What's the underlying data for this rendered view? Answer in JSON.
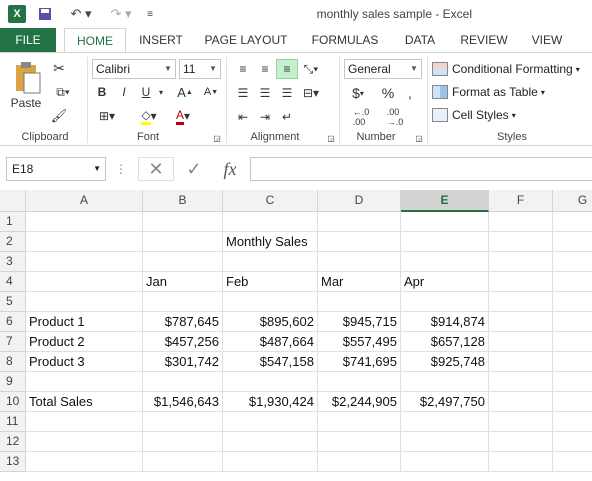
{
  "window": {
    "title": "monthly sales sample - Excel",
    "app_icon": "X"
  },
  "tabs": [
    "FILE",
    "HOME",
    "INSERT",
    "PAGE LAYOUT",
    "FORMULAS",
    "DATA",
    "REVIEW",
    "VIEW"
  ],
  "ribbon": {
    "clipboard": {
      "paste_label": "Paste",
      "group_label": "Clipboard"
    },
    "font": {
      "name": "Calibri",
      "size": "11",
      "group_label": "Font",
      "bold": "B",
      "italic": "I",
      "underline": "U"
    },
    "alignment": {
      "group_label": "Alignment"
    },
    "number": {
      "format": "General",
      "currency": "$",
      "percent": "%",
      "comma": ",",
      "group_label": "Number"
    },
    "styles": {
      "conditional": "Conditional Formatting",
      "format_table": "Format as Table",
      "cell_styles": "Cell Styles",
      "group_label": "Styles"
    }
  },
  "formula_bar": {
    "name_box": "E18",
    "fx": "fx",
    "value": ""
  },
  "columns": [
    "A",
    "B",
    "C",
    "D",
    "E",
    "F",
    "G"
  ],
  "selected_column": "E",
  "rows": [
    "1",
    "2",
    "3",
    "4",
    "5",
    "6",
    "7",
    "8",
    "9",
    "10",
    "11",
    "12",
    "13"
  ],
  "cells": {
    "c2": "Monthly Sales",
    "b4": "Jan",
    "c4": "Feb",
    "d4": "Mar",
    "e4": "Apr",
    "a6": "Product 1",
    "b6": "$787,645",
    "c6": "$895,602",
    "d6": "$945,715",
    "e6": "$914,874",
    "a7": "Product 2",
    "b7": "$457,256",
    "c7": "$487,664",
    "d7": "$557,495",
    "e7": "$657,128",
    "a8": "Product 3",
    "b8": "$301,742",
    "c8": "$547,158",
    "d8": "$741,695",
    "e8": "$925,748",
    "a10": "Total Sales",
    "b10": "$1,546,643",
    "c10": "$1,930,424",
    "d10": "$2,244,905",
    "e10": "$2,497,750"
  }
}
